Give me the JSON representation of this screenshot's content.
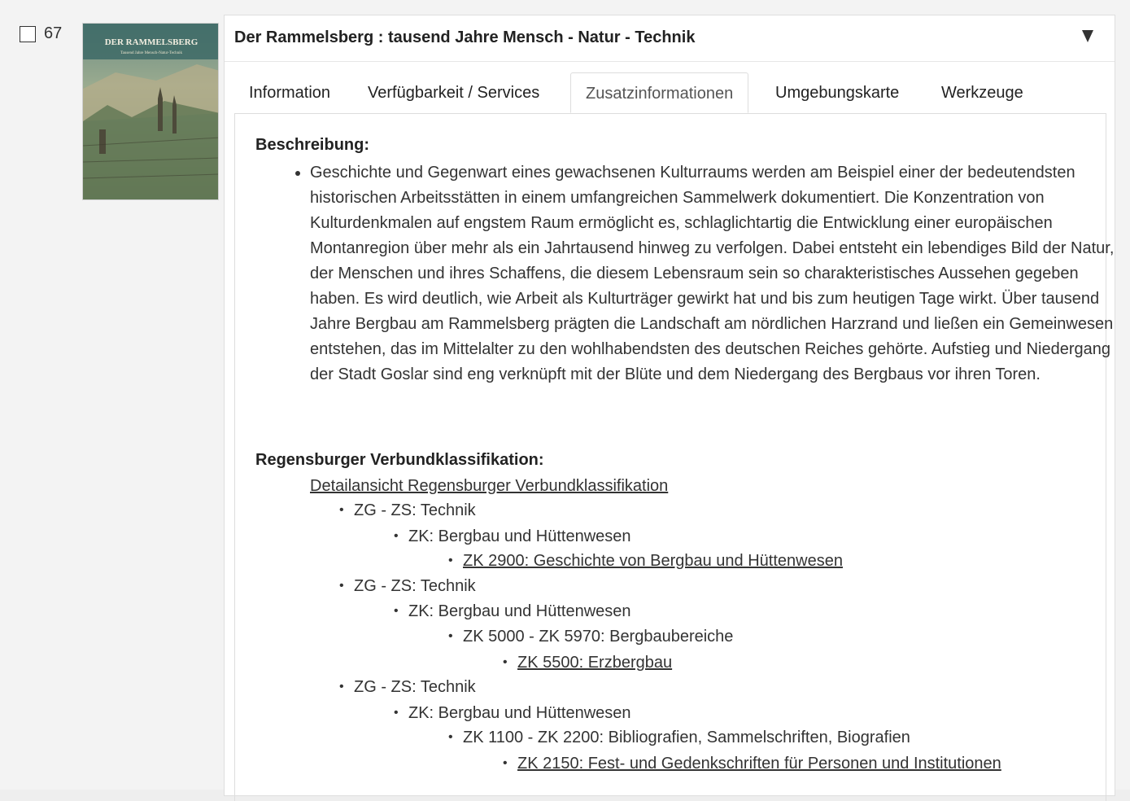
{
  "result": {
    "number": "67",
    "cover": {
      "title_text": "DER RAMMELSBERG",
      "subtitle_text": "Tausend Jahre Mensch-Natur-Technik"
    },
    "title": "Der Rammelsberg : tausend Jahre Mensch - Natur - Technik",
    "toggle": "▼"
  },
  "tabs": [
    {
      "label": "Information",
      "active": false
    },
    {
      "label": "Verfügbarkeit / Services",
      "active": false
    },
    {
      "label": "Zusatzinformationen",
      "active": true
    },
    {
      "label": "Umgebungskarte",
      "active": false
    },
    {
      "label": "Werkzeuge",
      "active": false
    }
  ],
  "beschreibung": {
    "heading": "Beschreibung:",
    "text": "Geschichte und Gegenwart eines gewachsenen Kulturraums werden am Beispiel einer der bedeutendsten historischen Arbeitsstätten in einem umfangreichen Sammelwerk dokumentiert. Die Konzentration von Kulturdenkmalen auf engstem Raum ermöglicht es, schlaglichtartig die Entwicklung einer europäischen Montanregion über mehr als ein Jahrtausend hinweg zu verfolgen. Dabei entsteht ein lebendiges Bild der Natur, der Menschen und ihres Schaffens, die diesem Lebensraum sein so charakteristisches Aussehen gegeben haben. Es wird deutlich, wie Arbeit als Kulturträger gewirkt hat und bis zum heutigen Tage wirkt. Über tausend Jahre Bergbau am Rammelsberg prägten die Landschaft am nördlichen Harzrand und ließen ein Gemeinwesen entstehen, das im Mittelalter zu den wohlhabendsten des deutschen Reiches gehörte. Aufstieg und Niedergang der Stadt Goslar sind eng verknüpft mit der Blüte und dem Niedergang des Bergbaus vor ihren Toren."
  },
  "rvk": {
    "heading": "Regensburger Verbundklassifikation:",
    "detail_link": "Detailansicht Regensburger Verbundklassifikation",
    "nodes": [
      {
        "text": "ZG - ZS: Technik",
        "level": 1,
        "link": false
      },
      {
        "text": "ZK: Bergbau und Hüttenwesen",
        "level": 2,
        "link": false
      },
      {
        "text": "ZK 2900: Geschichte von Bergbau und Hüttenwesen",
        "level": 3,
        "link": true
      },
      {
        "text": "ZG - ZS: Technik",
        "level": 1,
        "link": false
      },
      {
        "text": "ZK: Bergbau und Hüttenwesen",
        "level": 2,
        "link": false
      },
      {
        "text": "ZK 5000 - ZK 5970: Bergbaubereiche",
        "level": 3,
        "link": false
      },
      {
        "text": "ZK 5500: Erzbergbau",
        "level": 4,
        "link": true
      },
      {
        "text": "ZG - ZS: Technik",
        "level": 1,
        "link": false
      },
      {
        "text": "ZK: Bergbau und Hüttenwesen",
        "level": 2,
        "link": false
      },
      {
        "text": "ZK 1100 - ZK 2200: Bibliografien, Sammelschriften, Biografien",
        "level": 3,
        "link": false
      },
      {
        "text": "ZK 2150: Fest- und Gedenkschriften für Personen und Institutionen",
        "level": 4,
        "link": true
      }
    ]
  }
}
